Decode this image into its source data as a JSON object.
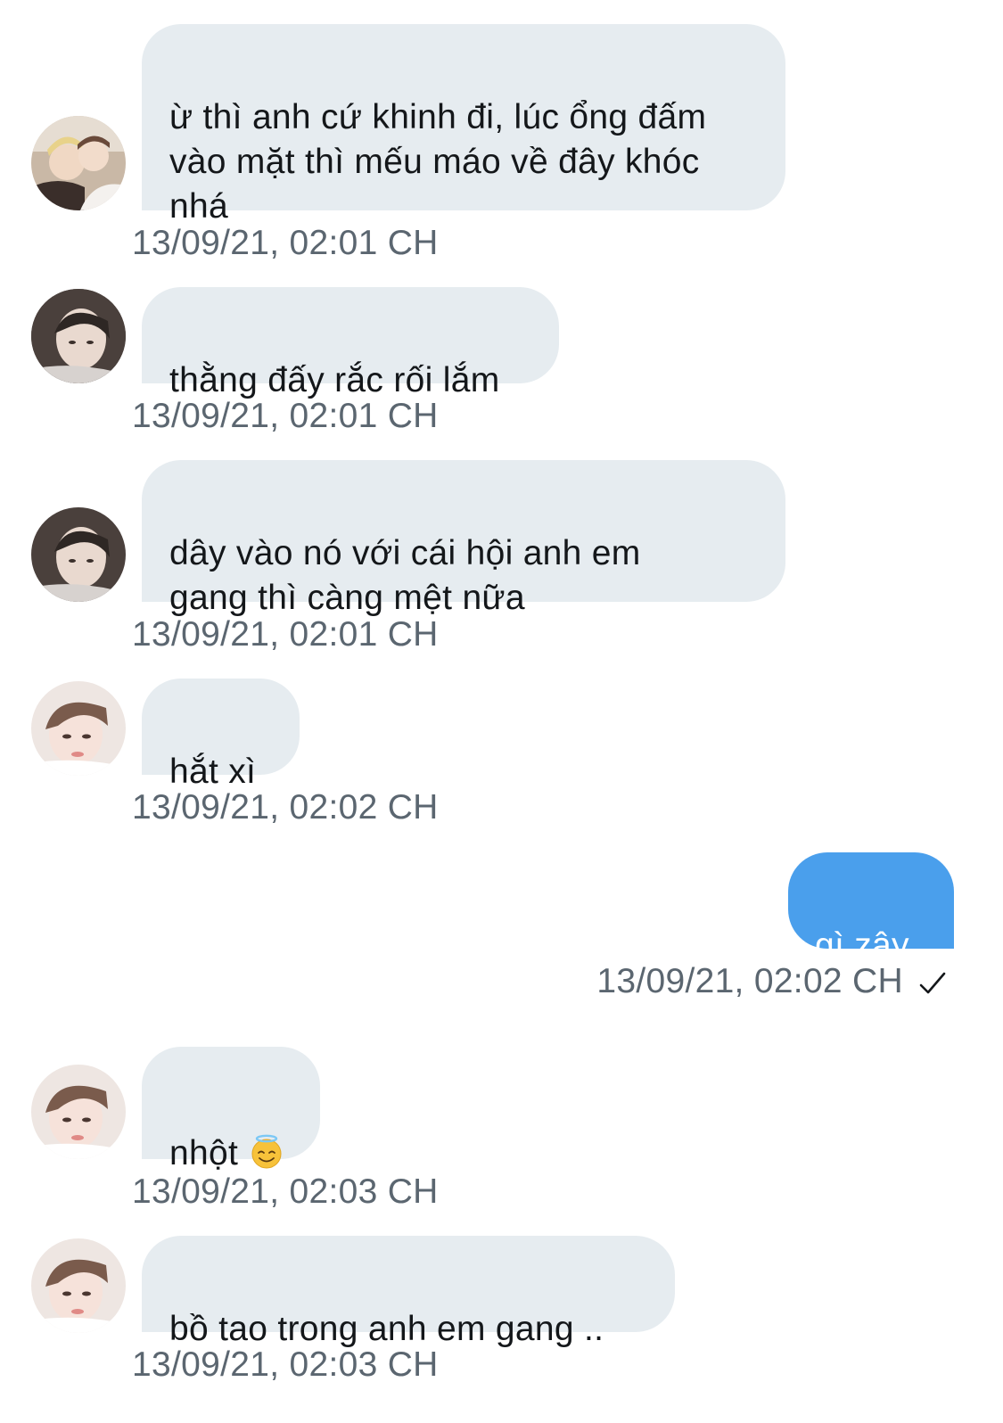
{
  "messages": [
    {
      "text": "ừ thì anh cứ khinh đi, lúc ổng đấm\nvào mặt thì mếu máo về đây khóc\nnhá",
      "time": "13/09/21, 02:01 CH"
    },
    {
      "text": "thằng đấy rắc rối lắm",
      "time": "13/09/21, 02:01 CH"
    },
    {
      "text": "dây vào nó với cái hội anh em\ngang thì càng mệt nữa",
      "time": "13/09/21, 02:01 CH"
    },
    {
      "text": "hắt xì",
      "time": "13/09/21, 02:02 CH"
    },
    {
      "text": "gì zậy",
      "time": "13/09/21, 02:02 CH"
    },
    {
      "text": "nhột",
      "emoji": "😇",
      "time": "13/09/21, 02:03 CH"
    },
    {
      "text": "bồ tao trong anh em gang ..",
      "time": "13/09/21, 02:03 CH"
    }
  ],
  "icons": {
    "sent_status": "checkmark-icon",
    "emoji": "smiling-face-with-halo"
  },
  "colors": {
    "incoming_bubble": "#e6ecf0",
    "outgoing_bubble": "#4a9fec",
    "timestamp": "#5b6670"
  }
}
